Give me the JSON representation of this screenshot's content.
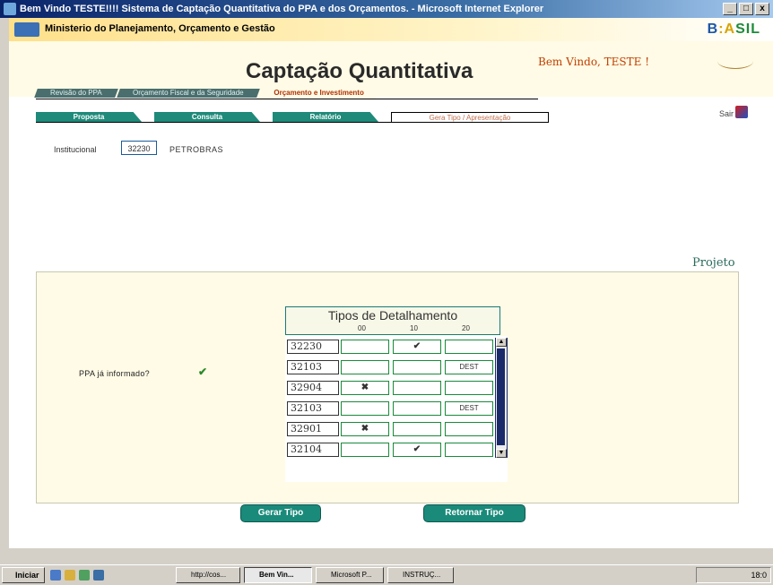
{
  "window": {
    "title": "Bem Vindo TESTE!!!! Sistema de Captação Quantitativa do PPA e dos Orçamentos. - Microsoft Internet Explorer",
    "buttons": {
      "minimize": "_",
      "maximize": "□",
      "close": "x"
    }
  },
  "ministry": {
    "name": "Ministerio do Planejamento, Orçamento e Gestão",
    "logo": {
      "b1": "B",
      "b2": ":A",
      "b3": "SIL"
    }
  },
  "header": {
    "title": "Captação Quantitativa",
    "welcome": "Bem Vindo, TESTE !"
  },
  "main_tabs": [
    {
      "label": "Revisão do PPA"
    },
    {
      "label": "Orçamento Fiscal e da Seguridade"
    },
    {
      "label": "Orçamento e Investimento"
    }
  ],
  "sub_tabs": [
    {
      "label": "Proposta"
    },
    {
      "label": "Consulta"
    },
    {
      "label": "Relatório"
    },
    {
      "label": "Gera Tipo / Apresentação"
    }
  ],
  "exit_label": "Sair",
  "institution": {
    "label": "Institucional",
    "code": "32230",
    "name": "PETROBRAS"
  },
  "section_label": "Projeto",
  "ppa": {
    "label": "PPA já informado?",
    "check": "✔"
  },
  "grid": {
    "title": "Tipos de Detalhamento",
    "columns": [
      "00",
      "10",
      "20"
    ],
    "rows": [
      {
        "code": "32230",
        "c0": "",
        "c1": "✔",
        "c2": ""
      },
      {
        "code": "32103",
        "c0": "",
        "c1": "",
        "c2": "DEST"
      },
      {
        "code": "32904",
        "c0": "✖",
        "c1": "",
        "c2": ""
      },
      {
        "code": "32103",
        "c0": "",
        "c1": "",
        "c2": "DEST"
      },
      {
        "code": "32901",
        "c0": "✖",
        "c1": "",
        "c2": ""
      },
      {
        "code": "32104",
        "c0": "",
        "c1": "✔",
        "c2": ""
      }
    ],
    "scroll_up": "▲",
    "scroll_down": "▼"
  },
  "actions": {
    "generate": "Gerar Tipo",
    "return": "Retornar Tipo"
  },
  "taskbar": {
    "start": "Iniciar",
    "buttons": [
      "http://cos...",
      "Bem Vin...",
      "Microsoft P...",
      "INSTRUÇ..."
    ],
    "clock": "18:0"
  }
}
